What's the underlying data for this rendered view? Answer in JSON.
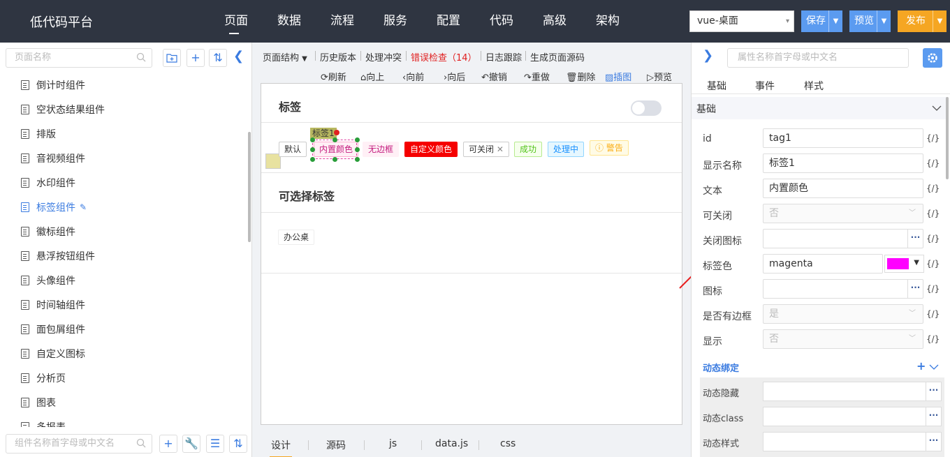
{
  "header": {
    "title": "低代码平台",
    "nav": [
      "页面",
      "数据",
      "流程",
      "服务",
      "配置",
      "代码",
      "高级",
      "架构"
    ],
    "env": "vue-桌面",
    "save": "保存",
    "preview": "预览",
    "publish": "发布"
  },
  "left": {
    "page_search_placeholder": "页面名称",
    "components": [
      "倒计时组件",
      "空状态结果组件",
      "排版",
      "音视频组件",
      "水印组件",
      "标签组件",
      "徽标组件",
      "悬浮按钮组件",
      "头像组件",
      "时间轴组件",
      "面包屑组件",
      "自定义图标",
      "分析页",
      "图表",
      "多报表"
    ],
    "active_index": 5,
    "component_search_placeholder": "组件名称首字母或中文名"
  },
  "center": {
    "toolbar": {
      "structure": "页面结构",
      "history": "历史版本",
      "conflict": "处理冲突",
      "error_check": "错误检查（14）",
      "log": "日志跟踪",
      "gen_source": "生成页面源码"
    },
    "actions": [
      "刷新",
      "向上",
      "向前",
      "向后",
      "撤销",
      "重做",
      "删除",
      "插图",
      "预览"
    ],
    "card1": {
      "title": "标签",
      "tags": [
        "默认",
        "内置颜色",
        "无边框",
        "自定义颜色",
        "可关闭",
        "成功",
        "处理中",
        "警告"
      ],
      "selected_label": "标签1"
    },
    "card2": {
      "title": "可选择标签",
      "tags": [
        "办公桌"
      ]
    },
    "bottom_tabs": [
      "设计",
      "源码",
      "js",
      "data.js",
      "css"
    ]
  },
  "right": {
    "search_placeholder": "属性名称首字母或中文名",
    "tabs": [
      "基础",
      "事件",
      "样式"
    ],
    "section": "基础",
    "props": {
      "id_label": "id",
      "id_value": "tag1",
      "display_label": "显示名称",
      "display_value": "标签1",
      "text_label": "文本",
      "text_value": "内置颜色",
      "closable_label": "可关闭",
      "closable_value": "否",
      "close_icon_label": "关闭图标",
      "color_label": "标签色",
      "color_value": "magenta",
      "icon_label": "图标",
      "border_label": "是否有边框",
      "border_value": "是",
      "visible_label": "显示",
      "visible_value": "否"
    },
    "fx": "{/}",
    "dynamic": {
      "title": "动态绑定",
      "hidden": "动态隐藏",
      "class": "动态class",
      "style": "动态样式"
    }
  },
  "colors": {
    "topbar": "#2f3541",
    "accent": "#3a7be0",
    "publish": "#f5a623",
    "tag_color": "#ff00ff"
  }
}
